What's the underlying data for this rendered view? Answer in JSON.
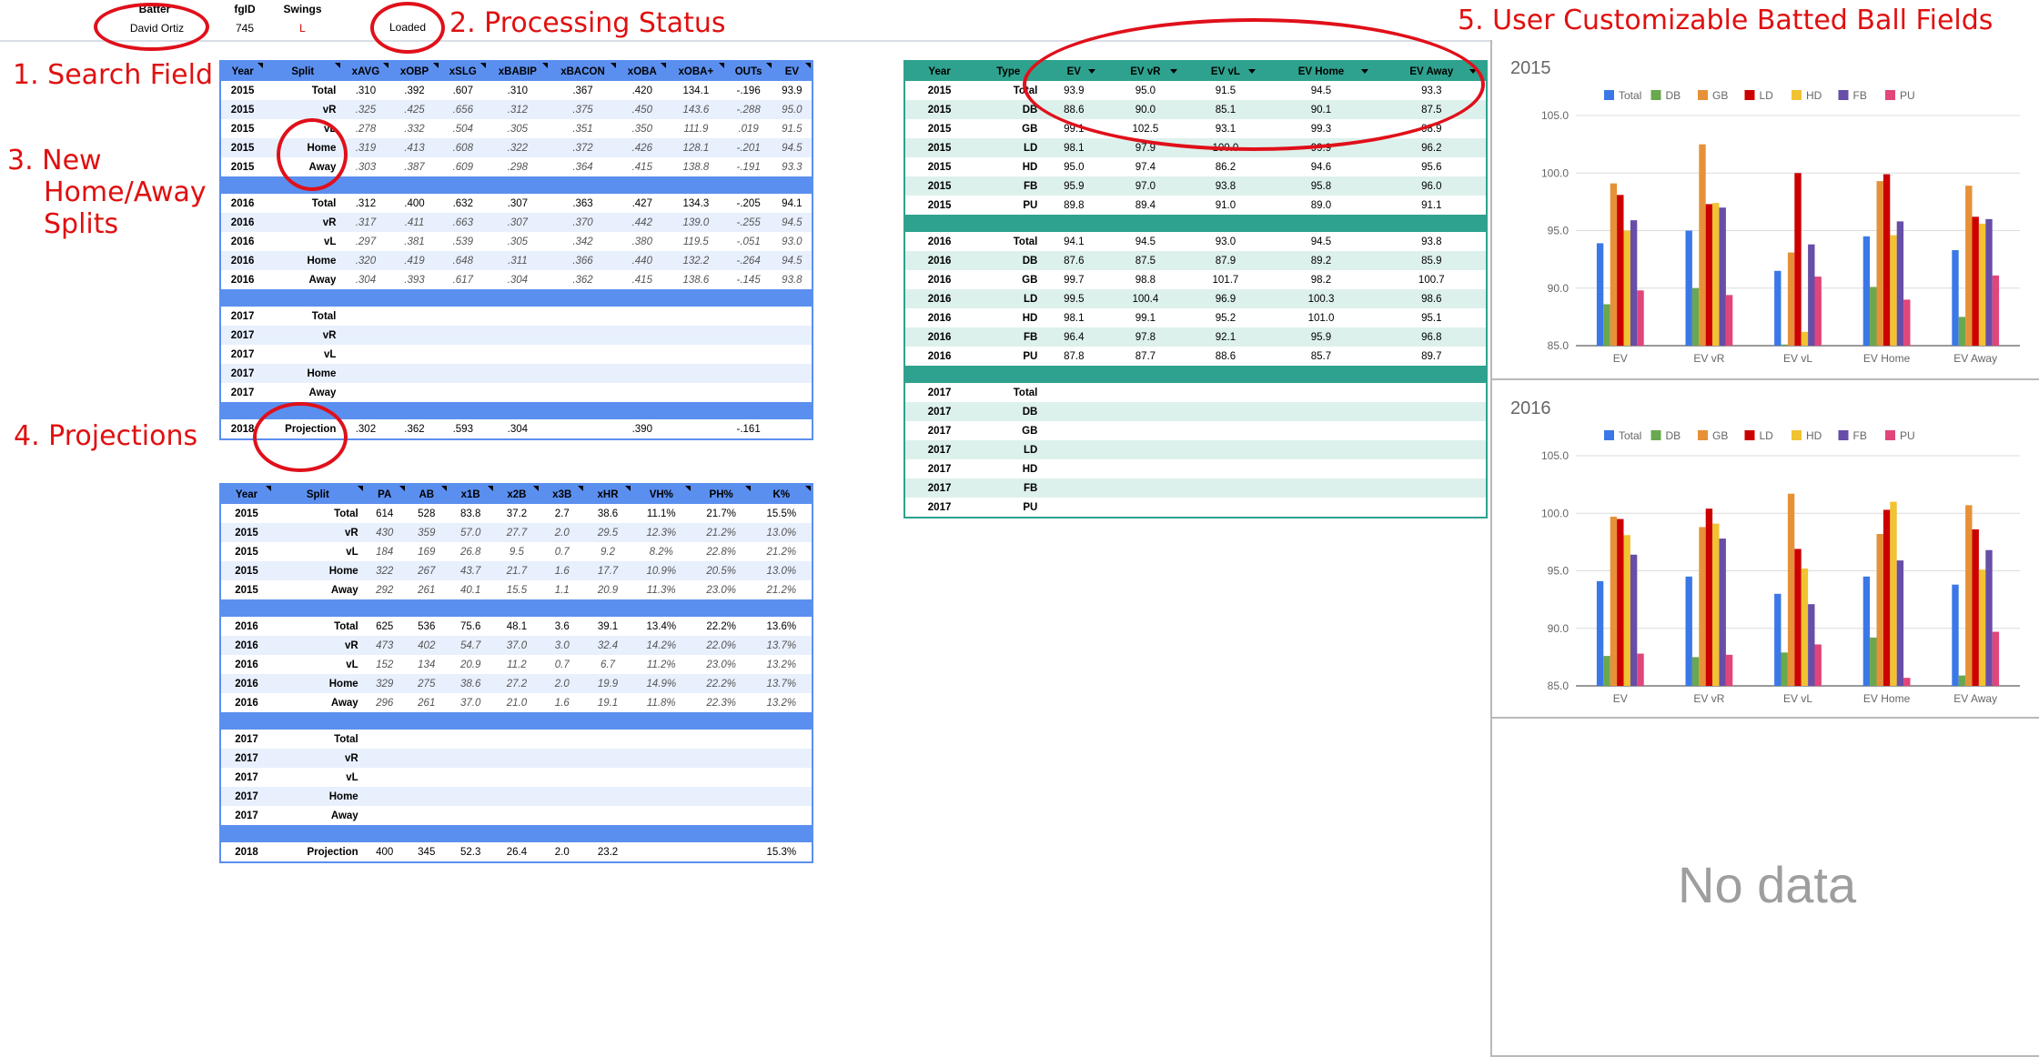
{
  "header": {
    "batter_label": "Batter",
    "batter_value": "David Ortiz",
    "fgid_label": "fgID",
    "fgid_value": "745",
    "swings_label": "Swings",
    "swings_value": "L",
    "status_value": "Loaded"
  },
  "annotations": {
    "search_field": "1. Search Field",
    "processing_status": "2. Processing Status",
    "home_away": [
      "3. New",
      "Home/Away",
      "Splits"
    ],
    "projections": "4. Projections",
    "batted_ball": "5. User Customizable Batted Ball Fields"
  },
  "table_stats": {
    "headers": [
      "Year",
      "Split",
      "xAVG",
      "xOBP",
      "xSLG",
      "xBABIP",
      "xBACON",
      "xOBA",
      "xOBA+",
      "OUTs",
      "EV"
    ],
    "groups": [
      [
        [
          "2015",
          "Total",
          ".310",
          ".392",
          ".607",
          ".310",
          ".367",
          ".420",
          "134.1",
          "-.196",
          "93.9"
        ],
        [
          "2015",
          "vR",
          ".325",
          ".425",
          ".656",
          ".312",
          ".375",
          ".450",
          "143.6",
          "-.288",
          "95.0"
        ],
        [
          "2015",
          "vL",
          ".278",
          ".332",
          ".504",
          ".305",
          ".351",
          ".350",
          "111.9",
          ".019",
          "91.5"
        ],
        [
          "2015",
          "Home",
          ".319",
          ".413",
          ".608",
          ".322",
          ".372",
          ".426",
          "128.1",
          "-.201",
          "94.5"
        ],
        [
          "2015",
          "Away",
          ".303",
          ".387",
          ".609",
          ".298",
          ".364",
          ".415",
          "138.8",
          "-.191",
          "93.3"
        ]
      ],
      [
        [
          "2016",
          "Total",
          ".312",
          ".400",
          ".632",
          ".307",
          ".363",
          ".427",
          "134.3",
          "-.205",
          "94.1"
        ],
        [
          "2016",
          "vR",
          ".317",
          ".411",
          ".663",
          ".307",
          ".370",
          ".442",
          "139.0",
          "-.255",
          "94.5"
        ],
        [
          "2016",
          "vL",
          ".297",
          ".381",
          ".539",
          ".305",
          ".342",
          ".380",
          "119.5",
          "-.051",
          "93.0"
        ],
        [
          "2016",
          "Home",
          ".320",
          ".419",
          ".648",
          ".311",
          ".366",
          ".440",
          "132.2",
          "-.264",
          "94.5"
        ],
        [
          "2016",
          "Away",
          ".304",
          ".393",
          ".617",
          ".304",
          ".362",
          ".415",
          "138.6",
          "-.145",
          "93.8"
        ]
      ],
      [
        [
          "2017",
          "Total",
          "",
          "",
          "",
          "",
          "",
          "",
          "",
          "",
          ""
        ],
        [
          "2017",
          "vR",
          "",
          "",
          "",
          "",
          "",
          "",
          "",
          "",
          ""
        ],
        [
          "2017",
          "vL",
          "",
          "",
          "",
          "",
          "",
          "",
          "",
          "",
          ""
        ],
        [
          "2017",
          "Home",
          "",
          "",
          "",
          "",
          "",
          "",
          "",
          "",
          ""
        ],
        [
          "2017",
          "Away",
          "",
          "",
          "",
          "",
          "",
          "",
          "",
          "",
          ""
        ]
      ],
      [
        [
          "2018",
          "Projection",
          ".302",
          ".362",
          ".593",
          ".304",
          "",
          ".390",
          "",
          "-.161",
          ""
        ]
      ]
    ]
  },
  "table_counts": {
    "headers": [
      "Year",
      "Split",
      "PA",
      "AB",
      "x1B",
      "x2B",
      "x3B",
      "xHR",
      "VH%",
      "PH%",
      "K%"
    ],
    "groups": [
      [
        [
          "2015",
          "Total",
          "614",
          "528",
          "83.8",
          "37.2",
          "2.7",
          "38.6",
          "11.1%",
          "21.7%",
          "15.5%"
        ],
        [
          "2015",
          "vR",
          "430",
          "359",
          "57.0",
          "27.7",
          "2.0",
          "29.5",
          "12.3%",
          "21.2%",
          "13.0%"
        ],
        [
          "2015",
          "vL",
          "184",
          "169",
          "26.8",
          "9.5",
          "0.7",
          "9.2",
          "8.2%",
          "22.8%",
          "21.2%"
        ],
        [
          "2015",
          "Home",
          "322",
          "267",
          "43.7",
          "21.7",
          "1.6",
          "17.7",
          "10.9%",
          "20.5%",
          "13.0%"
        ],
        [
          "2015",
          "Away",
          "292",
          "261",
          "40.1",
          "15.5",
          "1.1",
          "20.9",
          "11.3%",
          "23.0%",
          "21.2%"
        ]
      ],
      [
        [
          "2016",
          "Total",
          "625",
          "536",
          "75.6",
          "48.1",
          "3.6",
          "39.1",
          "13.4%",
          "22.2%",
          "13.6%"
        ],
        [
          "2016",
          "vR",
          "473",
          "402",
          "54.7",
          "37.0",
          "3.0",
          "32.4",
          "14.2%",
          "22.0%",
          "13.7%"
        ],
        [
          "2016",
          "vL",
          "152",
          "134",
          "20.9",
          "11.2",
          "0.7",
          "6.7",
          "11.2%",
          "23.0%",
          "13.2%"
        ],
        [
          "2016",
          "Home",
          "329",
          "275",
          "38.6",
          "27.2",
          "2.0",
          "19.9",
          "14.9%",
          "22.2%",
          "13.7%"
        ],
        [
          "2016",
          "Away",
          "296",
          "261",
          "37.0",
          "21.0",
          "1.6",
          "19.1",
          "11.8%",
          "22.3%",
          "13.2%"
        ]
      ],
      [
        [
          "2017",
          "Total",
          "",
          "",
          "",
          "",
          "",
          "",
          "",
          "",
          ""
        ],
        [
          "2017",
          "vR",
          "",
          "",
          "",
          "",
          "",
          "",
          "",
          "",
          ""
        ],
        [
          "2017",
          "vL",
          "",
          "",
          "",
          "",
          "",
          "",
          "",
          "",
          ""
        ],
        [
          "2017",
          "Home",
          "",
          "",
          "",
          "",
          "",
          "",
          "",
          "",
          ""
        ],
        [
          "2017",
          "Away",
          "",
          "",
          "",
          "",
          "",
          "",
          "",
          "",
          ""
        ]
      ],
      [
        [
          "2018",
          "Projection",
          "400",
          "345",
          "52.3",
          "26.4",
          "2.0",
          "23.2",
          "",
          "",
          "15.3%"
        ]
      ]
    ]
  },
  "table_ev": {
    "headers": [
      "Year",
      "Type",
      "EV",
      "EV vR",
      "EV vL",
      "EV Home",
      "EV Away"
    ],
    "groups": [
      [
        [
          "2015",
          "Total",
          "93.9",
          "95.0",
          "91.5",
          "94.5",
          "93.3"
        ],
        [
          "2015",
          "DB",
          "88.6",
          "90.0",
          "85.1",
          "90.1",
          "87.5"
        ],
        [
          "2015",
          "GB",
          "99.1",
          "102.5",
          "93.1",
          "99.3",
          "98.9"
        ],
        [
          "2015",
          "LD",
          "98.1",
          "97.9",
          "100.0",
          "99.9",
          "96.2"
        ],
        [
          "2015",
          "HD",
          "95.0",
          "97.4",
          "86.2",
          "94.6",
          "95.6"
        ],
        [
          "2015",
          "FB",
          "95.9",
          "97.0",
          "93.8",
          "95.8",
          "96.0"
        ],
        [
          "2015",
          "PU",
          "89.8",
          "89.4",
          "91.0",
          "89.0",
          "91.1"
        ]
      ],
      [
        [
          "2016",
          "Total",
          "94.1",
          "94.5",
          "93.0",
          "94.5",
          "93.8"
        ],
        [
          "2016",
          "DB",
          "87.6",
          "87.5",
          "87.9",
          "89.2",
          "85.9"
        ],
        [
          "2016",
          "GB",
          "99.7",
          "98.8",
          "101.7",
          "98.2",
          "100.7"
        ],
        [
          "2016",
          "LD",
          "99.5",
          "100.4",
          "96.9",
          "100.3",
          "98.6"
        ],
        [
          "2016",
          "HD",
          "98.1",
          "99.1",
          "95.2",
          "101.0",
          "95.1"
        ],
        [
          "2016",
          "FB",
          "96.4",
          "97.8",
          "92.1",
          "95.9",
          "96.8"
        ],
        [
          "2016",
          "PU",
          "87.8",
          "87.7",
          "88.6",
          "85.7",
          "89.7"
        ]
      ],
      [
        [
          "2017",
          "Total",
          "",
          "",
          "",
          "",
          ""
        ],
        [
          "2017",
          "DB",
          "",
          "",
          "",
          "",
          ""
        ],
        [
          "2017",
          "GB",
          "",
          "",
          "",
          "",
          ""
        ],
        [
          "2017",
          "LD",
          "",
          "",
          "",
          "",
          ""
        ],
        [
          "2017",
          "HD",
          "",
          "",
          "",
          "",
          ""
        ],
        [
          "2017",
          "FB",
          "",
          "",
          "",
          "",
          ""
        ],
        [
          "2017",
          "PU",
          "",
          "",
          "",
          "",
          ""
        ]
      ]
    ]
  },
  "chart_data": [
    {
      "type": "bar",
      "title": "2015",
      "categories": [
        "EV",
        "EV vR",
        "EV vL",
        "EV Home",
        "EV Away"
      ],
      "ylim": [
        85,
        105
      ],
      "yticks": [
        "85.0",
        "90.0",
        "95.0",
        "100.0",
        "105.0"
      ],
      "grid": true,
      "legend": "top",
      "series": [
        {
          "name": "Total",
          "color": "#3b78e7",
          "values": [
            93.9,
            95.0,
            91.5,
            94.5,
            93.3
          ]
        },
        {
          "name": "DB",
          "color": "#6aa84f",
          "values": [
            88.6,
            90.0,
            85.1,
            90.1,
            87.5
          ]
        },
        {
          "name": "GB",
          "color": "#e69138",
          "values": [
            99.1,
            102.5,
            93.1,
            99.3,
            98.9
          ]
        },
        {
          "name": "LD",
          "color": "#cc0000",
          "values": [
            98.1,
            97.3,
            100.0,
            99.9,
            96.2
          ]
        },
        {
          "name": "HD",
          "color": "#f1c232",
          "values": [
            95.0,
            97.4,
            86.2,
            94.6,
            95.6
          ]
        },
        {
          "name": "FB",
          "color": "#674ea7",
          "values": [
            95.9,
            97.0,
            93.8,
            95.8,
            96.0
          ]
        },
        {
          "name": "PU",
          "color": "#e0457b",
          "values": [
            89.8,
            89.4,
            91.0,
            89.0,
            91.1
          ]
        }
      ]
    },
    {
      "type": "bar",
      "title": "2016",
      "categories": [
        "EV",
        "EV vR",
        "EV vL",
        "EV Home",
        "EV Away"
      ],
      "ylim": [
        85,
        105
      ],
      "yticks": [
        "85.0",
        "90.0",
        "95.0",
        "100.0",
        "105.0"
      ],
      "grid": true,
      "legend": "top",
      "series": [
        {
          "name": "Total",
          "color": "#3b78e7",
          "values": [
            94.1,
            94.5,
            93.0,
            94.5,
            93.8
          ]
        },
        {
          "name": "DB",
          "color": "#6aa84f",
          "values": [
            87.6,
            87.5,
            87.9,
            89.2,
            85.9
          ]
        },
        {
          "name": "GB",
          "color": "#e69138",
          "values": [
            99.7,
            98.8,
            101.7,
            98.2,
            100.7
          ]
        },
        {
          "name": "LD",
          "color": "#cc0000",
          "values": [
            99.5,
            100.4,
            96.9,
            100.3,
            98.6
          ]
        },
        {
          "name": "HD",
          "color": "#f1c232",
          "values": [
            98.1,
            99.1,
            95.2,
            101.0,
            95.1
          ]
        },
        {
          "name": "FB",
          "color": "#674ea7",
          "values": [
            96.4,
            97.8,
            92.1,
            95.9,
            96.8
          ]
        },
        {
          "name": "PU",
          "color": "#e0457b",
          "values": [
            87.8,
            87.7,
            88.6,
            85.7,
            89.7
          ]
        }
      ]
    }
  ],
  "empty_chart": {
    "message": "No data"
  }
}
